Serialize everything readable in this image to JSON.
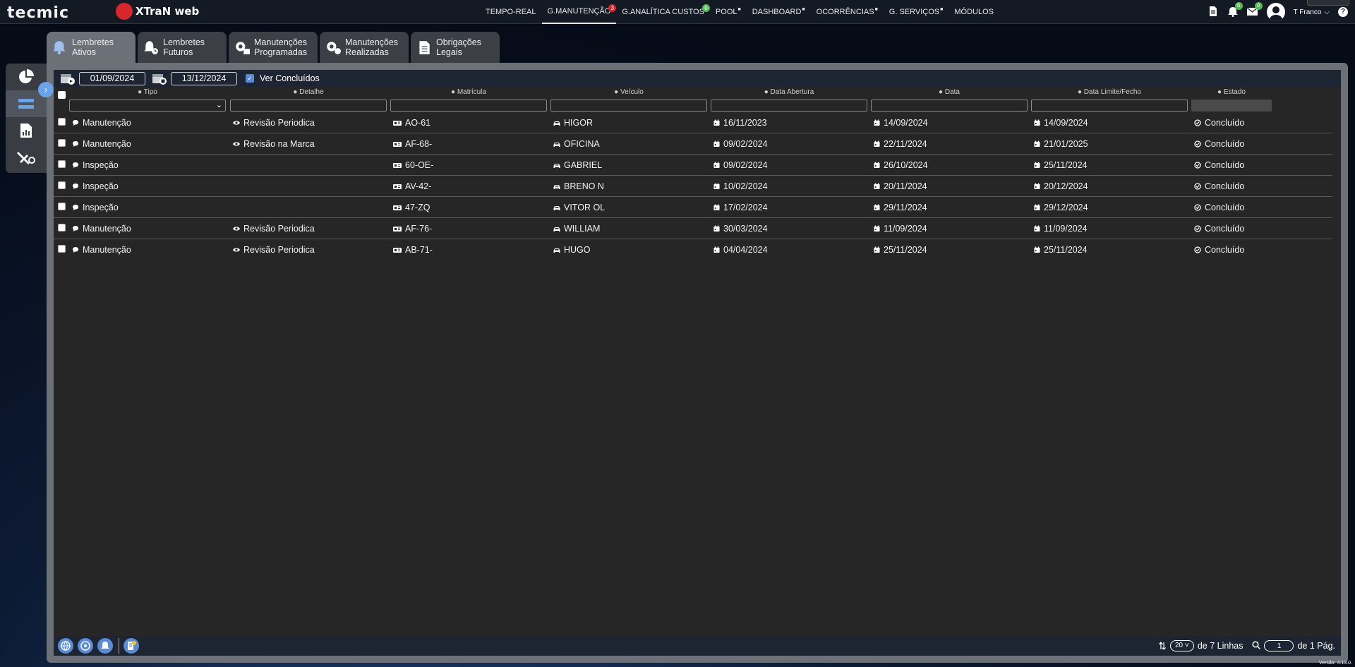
{
  "brand": {
    "logo": "tecmic",
    "product": "XTraN web"
  },
  "nav": {
    "items": [
      {
        "label": "TEMPO-REAL"
      },
      {
        "label": "G.MANUTENÇÃO",
        "badge": "3",
        "badge_color": "#d7262e"
      },
      {
        "label": "G.ANALÍTICA CUSTOS",
        "badge": "0",
        "badge_color": "#5cb85c"
      },
      {
        "label": "POOL",
        "lock": true
      },
      {
        "label": "DASHBOARD",
        "lock": true
      },
      {
        "label": "OCORRÊNCIAS",
        "lock": true
      },
      {
        "label": "G. SERVIÇOS",
        "lock": true
      },
      {
        "label": "MÓDULOS"
      }
    ]
  },
  "topright": {
    "notif_badge": "0",
    "mail_badge": "0",
    "user": "T Franco"
  },
  "tabs": [
    {
      "line1": "Lembretes",
      "line2": "Ativos",
      "icon": "bell-ring-icon"
    },
    {
      "line1": "Lembretes",
      "line2": "Futuros",
      "icon": "bell-clock-icon"
    },
    {
      "line1": "Manutenções",
      "line2": "Programadas",
      "icon": "gears-calendar-icon"
    },
    {
      "line1": "Manutenções",
      "line2": "Realizadas",
      "icon": "gears-check-icon"
    },
    {
      "line1": "Obrigações",
      "line2": "Legais",
      "icon": "document-icon"
    }
  ],
  "filters": {
    "date_from": "01/09/2024",
    "date_to": "13/12/2024",
    "show_done_label": "Ver Concluídos"
  },
  "columns": [
    "Tipo",
    "Detalhe",
    "Matrícula",
    "Veículo",
    "Data Abertura",
    "Data",
    "Data Limite/Fecho",
    "Estado"
  ],
  "rows": [
    {
      "tipo": "Manutenção",
      "detalhe": "Revisão Periodica",
      "matricula": "AO-61",
      "veiculo": "HIGOR",
      "abertura": "16/11/2023",
      "data": "14/09/2024",
      "limite": "14/09/2024",
      "estado": "Concluído"
    },
    {
      "tipo": "Manutenção",
      "detalhe": "Revisão na Marca",
      "matricula": "AF-68-",
      "veiculo": "OFICINA",
      "abertura": "09/02/2024",
      "data": "22/11/2024",
      "limite": "21/01/2025",
      "estado": "Concluído"
    },
    {
      "tipo": "Inspeção",
      "detalhe": "",
      "matricula": "60-OE-",
      "veiculo": "GABRIEL",
      "abertura": "09/02/2024",
      "data": "26/10/2024",
      "limite": "25/11/2024",
      "estado": "Concluído"
    },
    {
      "tipo": "Inspeção",
      "detalhe": "",
      "matricula": "AV-42-",
      "veiculo": "BRENO N",
      "abertura": "10/02/2024",
      "data": "20/11/2024",
      "limite": "20/12/2024",
      "estado": "Concluído"
    },
    {
      "tipo": "Inspeção",
      "detalhe": "",
      "matricula": "47-ZQ",
      "veiculo": "VITOR OL",
      "abertura": "17/02/2024",
      "data": "29/11/2024",
      "limite": "29/12/2024",
      "estado": "Concluído"
    },
    {
      "tipo": "Manutenção",
      "detalhe": "Revisão Periodica",
      "matricula": "AF-76-",
      "veiculo": "WILLIAM",
      "abertura": "30/03/2024",
      "data": "11/09/2024",
      "limite": "11/09/2024",
      "estado": "Concluído"
    },
    {
      "tipo": "Manutenção",
      "detalhe": "Revisão Periodica",
      "matricula": "AB-71-",
      "veiculo": "HUGO",
      "abertura": "04/04/2024",
      "data": "25/11/2024",
      "limite": "25/11/2024",
      "estado": "Concluído"
    }
  ],
  "footer": {
    "page_size": "20",
    "rows_label": "de 7 Linhas",
    "page": "1",
    "pages_label": "de 1 Pág."
  },
  "version": "Versão: 4.13.0."
}
